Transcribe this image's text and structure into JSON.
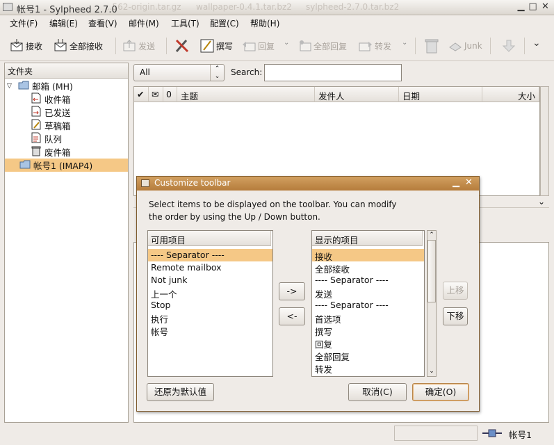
{
  "window": {
    "title": "帐号1 - Sylpheed 2.7.0",
    "background_titles": [
      "sylpheed-2.7.0.tar.bz2",
      "wallpaper-0.4.1.tar.bz2",
      "...562-origin.tar.gz"
    ]
  },
  "menubar": [
    {
      "label": "文件(F)"
    },
    {
      "label": "编辑(E)"
    },
    {
      "label": "查看(V)"
    },
    {
      "label": "邮件(M)"
    },
    {
      "label": "工具(T)"
    },
    {
      "label": "配置(C)"
    },
    {
      "label": "帮助(H)"
    }
  ],
  "toolbar": {
    "buttons": [
      {
        "label": "接收",
        "icon": "receive-icon",
        "enabled": true
      },
      {
        "label": "全部接收",
        "icon": "receive-all-icon",
        "enabled": true
      },
      {
        "label": "发送",
        "icon": "send-icon",
        "enabled": false
      },
      {
        "label": "",
        "icon": "preferences-icon",
        "enabled": true
      },
      {
        "label": "撰写",
        "icon": "compose-icon",
        "enabled": true
      },
      {
        "label": "回复",
        "icon": "reply-icon",
        "enabled": false
      },
      {
        "label": "全部回复",
        "icon": "reply-all-icon",
        "enabled": false
      },
      {
        "label": "转发",
        "icon": "forward-icon",
        "enabled": false
      },
      {
        "label": "",
        "icon": "trash-icon",
        "enabled": false
      },
      {
        "label": "Junk",
        "icon": "junk-icon",
        "enabled": false
      },
      {
        "label": "",
        "icon": "next-icon",
        "enabled": false
      }
    ]
  },
  "folder_pane": {
    "header": "文件夹",
    "items": [
      {
        "label": "邮箱 (MH)",
        "level": 0,
        "icon": "mailbox-folder-icon",
        "expanded": true
      },
      {
        "label": "收件箱",
        "level": 1,
        "icon": "inbox-icon"
      },
      {
        "label": "已发送",
        "level": 1,
        "icon": "sent-icon"
      },
      {
        "label": "草稿箱",
        "level": 1,
        "icon": "drafts-icon"
      },
      {
        "label": "队列",
        "level": 1,
        "icon": "queue-icon"
      },
      {
        "label": "废件箱",
        "level": 1,
        "icon": "trash-icon"
      },
      {
        "label": "帐号1 (IMAP4)",
        "level": 0,
        "icon": "imap-folder-icon",
        "selected": true
      }
    ]
  },
  "filter": {
    "selected": "All",
    "search_label": "Search:",
    "search_value": ""
  },
  "message_list": {
    "columns": [
      "✔",
      "✉",
      "0",
      "主题",
      "发件人",
      "日期",
      "大小"
    ]
  },
  "status_bar": {
    "account": "帐号1"
  },
  "dialog": {
    "title": "Customize toolbar",
    "description": "Select items to be displayed on the toolbar. You can modify the order by using the Up / Down button.",
    "available_header": "可用项目",
    "available_items": [
      "---- Separator ----",
      "Remote mailbox",
      "Not junk",
      "上一个",
      "Stop",
      "执行",
      "帐号"
    ],
    "available_selected_index": 0,
    "displayed_header": "显示的项目",
    "displayed_items": [
      "接收",
      "全部接收",
      "---- Separator ----",
      "发送",
      "---- Separator ----",
      "首选项",
      "撰写",
      "回复",
      "全部回复",
      "转发"
    ],
    "displayed_selected_index": 0,
    "add_button": "->",
    "remove_button": "<-",
    "up_button": "上移",
    "down_button": "下移",
    "reset_button": "还原为默认值",
    "cancel_button": "取消(C)",
    "ok_button": "确定(O)"
  },
  "colors": {
    "selection": "#f5c886",
    "dialog_title_bar": "#c18a47",
    "window_bg": "#efebe7"
  }
}
